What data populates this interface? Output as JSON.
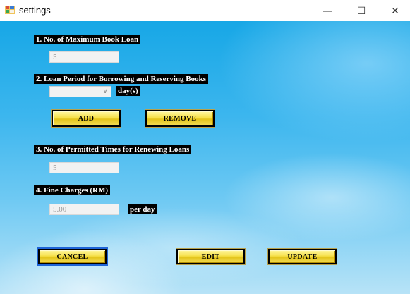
{
  "window": {
    "title": "settings",
    "icon": "winforms-app-icon",
    "controls": {
      "minimize": "—",
      "maximize": "☐",
      "close": "✕"
    }
  },
  "form": {
    "max_loan": {
      "label": "1. No. of Maximum Book Loan",
      "value": "5"
    },
    "loan_period": {
      "label": "2. Loan Period for Borrowing and Reserving Books",
      "selected": "",
      "unit": "day(s)",
      "add_label": "ADD",
      "remove_label": "REMOVE"
    },
    "renew": {
      "label": "3. No. of Permitted Times for Renewing Loans",
      "value": "5"
    },
    "fine": {
      "label": "4. Fine Charges (RM)",
      "value": "5.00",
      "unit": "per day"
    }
  },
  "actions": {
    "cancel_label": "CANCEL",
    "edit_label": "EDIT",
    "update_label": "UPDATE"
  },
  "colors": {
    "button_fill": "#f6e04a",
    "background_sky": "#3cb6ee",
    "label_bg": "#000000"
  }
}
